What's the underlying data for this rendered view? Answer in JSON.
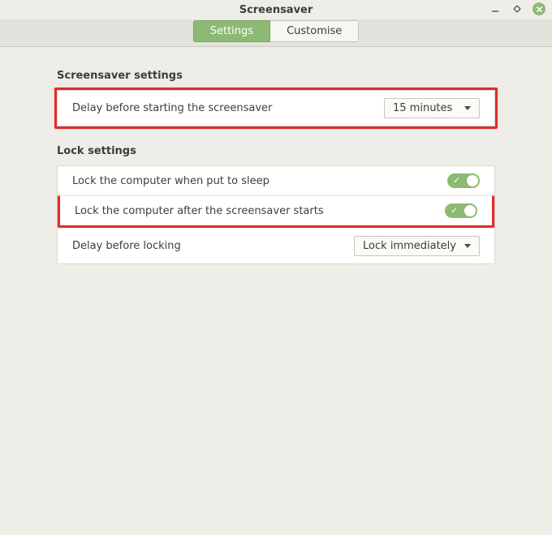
{
  "window": {
    "title": "Screensaver"
  },
  "tabs": {
    "settings": "Settings",
    "customise": "Customise"
  },
  "sections": {
    "screensaver_heading": "Screensaver settings",
    "lock_heading": "Lock settings"
  },
  "rows": {
    "delay_start_label": "Delay before starting the screensaver",
    "delay_start_value": "15 minutes",
    "lock_sleep_label": "Lock the computer when put to sleep",
    "lock_after_ss_label": "Lock the computer after the screensaver starts",
    "delay_lock_label": "Delay before locking",
    "delay_lock_value": "Lock immediately"
  },
  "toggles": {
    "lock_sleep_on": true,
    "lock_after_ss_on": true
  },
  "colors": {
    "accent": "#8cb973",
    "highlight": "#e12b2b"
  }
}
